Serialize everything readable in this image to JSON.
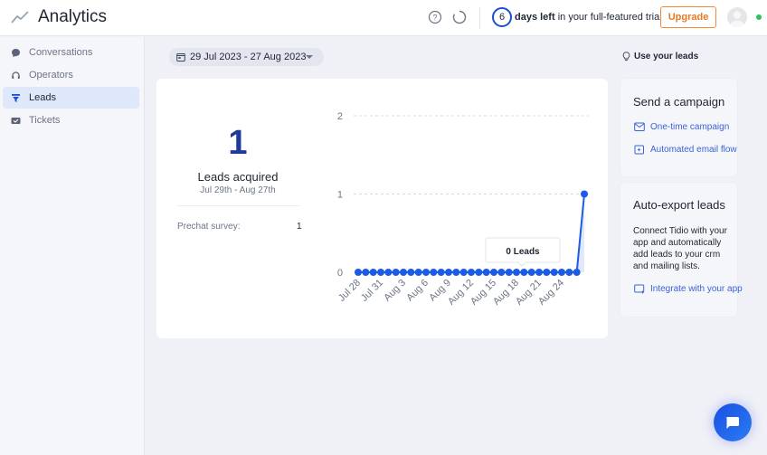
{
  "header": {
    "title": "Analytics",
    "days_left_number": "6",
    "days_left_bold": "days left",
    "trial_suffix": " in your full-featured trial",
    "upgrade_label": "Upgrade",
    "status_color": "#2ec15a"
  },
  "sidebar": {
    "items": [
      {
        "label": "Conversations",
        "icon": "chat-bubble-icon",
        "active": false
      },
      {
        "label": "Operators",
        "icon": "headset-icon",
        "active": false
      },
      {
        "label": "Leads",
        "icon": "funnel-icon",
        "active": true
      },
      {
        "label": "Tickets",
        "icon": "ticket-icon",
        "active": false
      }
    ]
  },
  "toolbar": {
    "date_range": "29 Jul 2023 - 27 Aug 2023",
    "use_leads_label": "Use your leads"
  },
  "summary": {
    "count": "1",
    "label": "Leads acquired",
    "range": "Jul 29th - Aug 27th",
    "breakdown": [
      {
        "label": "Prechat survey:",
        "value": "1"
      }
    ]
  },
  "tooltip": {
    "text": "0 Leads"
  },
  "chart_data": {
    "type": "line",
    "title": "",
    "xlabel": "",
    "ylabel": "",
    "ylim": [
      0,
      2
    ],
    "yticks": [
      "0",
      "1",
      "2"
    ],
    "grid": true,
    "x": [
      "Jul 28",
      "Jul 29",
      "Jul 30",
      "Jul 31",
      "Aug 1",
      "Aug 2",
      "Aug 3",
      "Aug 4",
      "Aug 5",
      "Aug 6",
      "Aug 7",
      "Aug 8",
      "Aug 9",
      "Aug 10",
      "Aug 11",
      "Aug 12",
      "Aug 13",
      "Aug 14",
      "Aug 15",
      "Aug 16",
      "Aug 17",
      "Aug 18",
      "Aug 19",
      "Aug 20",
      "Aug 21",
      "Aug 22",
      "Aug 23",
      "Aug 24",
      "Aug 25",
      "Aug 26",
      "Aug 27"
    ],
    "xtick_labels": [
      "Jul 28",
      "Jul 31",
      "Aug 3",
      "Aug 6",
      "Aug 9",
      "Aug 12",
      "Aug 15",
      "Aug 18",
      "Aug 21",
      "Aug 24"
    ],
    "series": [
      {
        "name": "Leads",
        "color": "#1c5be6",
        "values": [
          0,
          0,
          0,
          0,
          0,
          0,
          0,
          0,
          0,
          0,
          0,
          0,
          0,
          0,
          0,
          0,
          0,
          0,
          0,
          0,
          0,
          0,
          0,
          0,
          0,
          0,
          0,
          0,
          0,
          0,
          1
        ]
      }
    ]
  },
  "campaign_card": {
    "title": "Send a campaign",
    "links": [
      {
        "label": "One-time campaign",
        "icon": "mail-icon"
      },
      {
        "label": "Automated email flow",
        "icon": "automation-icon"
      }
    ]
  },
  "export_card": {
    "title": "Auto-export leads",
    "description": "Connect Tidio with your app and automatically add leads to your crm and mailing lists.",
    "link_label": "Integrate with your app"
  }
}
